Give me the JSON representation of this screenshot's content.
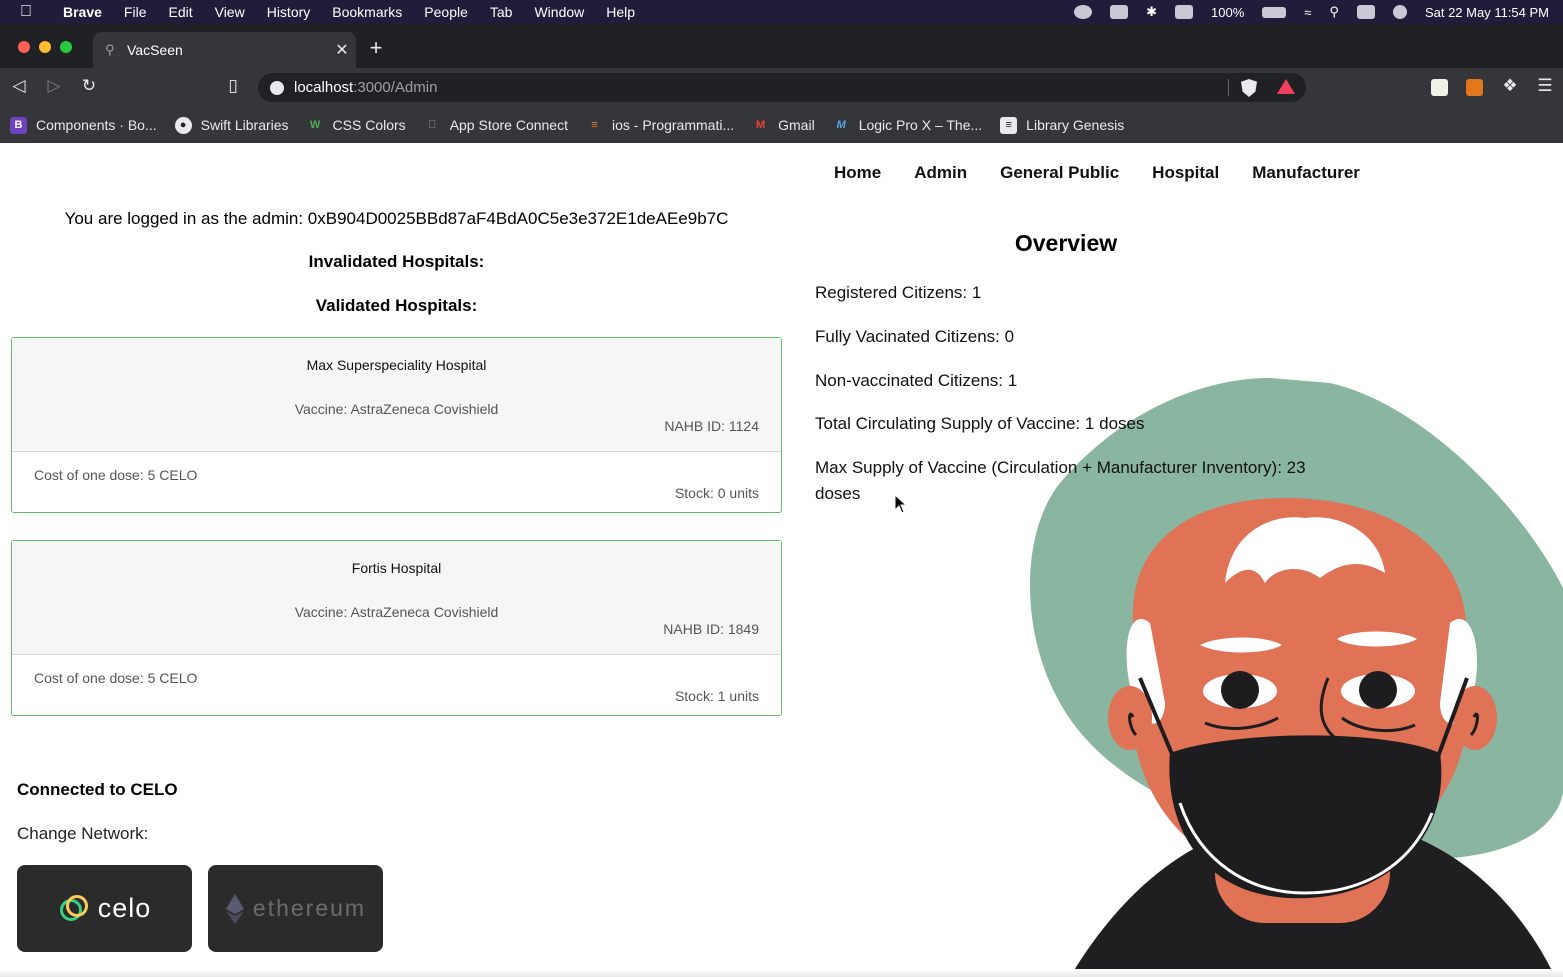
{
  "menubar": {
    "app": "Brave",
    "items": [
      "File",
      "Edit",
      "View",
      "History",
      "Bookmarks",
      "People",
      "Tab",
      "Window",
      "Help"
    ],
    "battery": "100%",
    "datetime": "Sat 22 May  11:54 PM"
  },
  "browser": {
    "tab_title": "VacSeen",
    "url_host": "localhost",
    "url_path": ":3000/Admin",
    "bookmarks": [
      {
        "label": "Components · Bo...",
        "icon": "bootstrap-icon"
      },
      {
        "label": "Swift Libraries",
        "icon": "github-icon"
      },
      {
        "label": "CSS Colors",
        "icon": "w3-icon"
      },
      {
        "label": "App Store Connect",
        "icon": "apple-icon"
      },
      {
        "label": "ios - Programmati...",
        "icon": "stackoverflow-icon"
      },
      {
        "label": "Gmail",
        "icon": "gmail-icon"
      },
      {
        "label": "Logic Pro X – The...",
        "icon": "logic-icon"
      },
      {
        "label": "Library Genesis",
        "icon": "book-icon"
      }
    ]
  },
  "nav": {
    "items": [
      "Home",
      "Admin",
      "General Public",
      "Hospital",
      "Manufacturer"
    ]
  },
  "admin": {
    "logged_in": "You are logged in as the admin: 0xB904D0025BBd87aF4BdA0C5e3e372E1deAEe9b7C",
    "invalidated_title": "Invalidated Hospitals:",
    "validated_title": "Validated Hospitals:",
    "hospitals": [
      {
        "name": "Max Superspeciality Hospital",
        "vaccine": "Vaccine: AstraZeneca Covishield",
        "nahb": "NAHB ID: 1124",
        "cost": "Cost of one dose: 5 CELO",
        "stock": "Stock: 0 units"
      },
      {
        "name": "Fortis Hospital",
        "vaccine": "Vaccine: AstraZeneca Covishield",
        "nahb": "NAHB ID: 1849",
        "cost": "Cost of one dose: 5 CELO",
        "stock": "Stock: 1 units"
      }
    ],
    "connected": "Connected to CELO",
    "change_network": "Change Network:",
    "networks": [
      {
        "label": "celo",
        "color": "#ffffff",
        "icon": "celo-logo-icon"
      },
      {
        "label": "ethereum",
        "color": "#6b6b6b",
        "icon": "ethereum-logo-icon"
      }
    ]
  },
  "overview": {
    "title": "Overview",
    "stats": [
      "Registered Citizens: 1",
      "Fully Vacinated Citizens: 0",
      "Non-vaccinated Citizens: 1",
      "Total Circulating Supply of Vaccine: 1 doses",
      "Max Supply of Vaccine (Circulation + Manufacturer Inventory): 23 doses"
    ]
  },
  "colors": {
    "card_border": "#66bb6a",
    "illustration_bg": "#8ab5a0",
    "skin": "#e07256",
    "mask": "#1d1d1f"
  }
}
